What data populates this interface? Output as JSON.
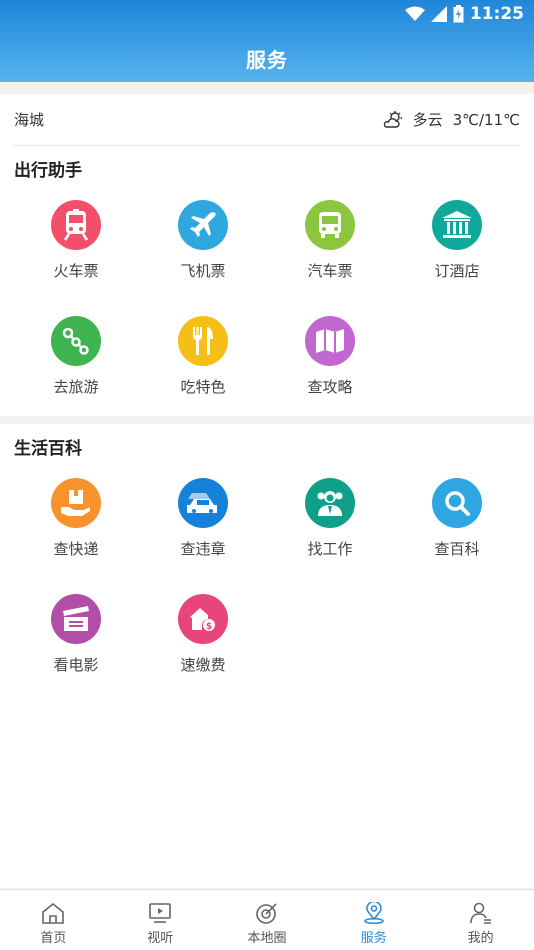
{
  "status": {
    "time": "11:25"
  },
  "header": {
    "title": "服务"
  },
  "weather": {
    "city": "海城",
    "condition": "多云",
    "temperature": "3℃/11℃"
  },
  "sections": [
    {
      "title": "出行助手",
      "items": [
        {
          "label": "火车票",
          "icon": "train-icon",
          "color": "#f24f6b"
        },
        {
          "label": "飞机票",
          "icon": "airplane-icon",
          "color": "#2fa8e0"
        },
        {
          "label": "汽车票",
          "icon": "bus-icon",
          "color": "#8cc63f"
        },
        {
          "label": "订酒店",
          "icon": "hotel-icon",
          "color": "#0fa89b"
        },
        {
          "label": "去旅游",
          "icon": "route-icon",
          "color": "#3fb34f"
        },
        {
          "label": "吃特色",
          "icon": "food-icon",
          "color": "#f6bf17"
        },
        {
          "label": "查攻略",
          "icon": "map-icon",
          "color": "#c068d0"
        }
      ]
    },
    {
      "title": "生活百科",
      "items": [
        {
          "label": "查快递",
          "icon": "package-icon",
          "color": "#f7922c"
        },
        {
          "label": "查违章",
          "icon": "car-icon",
          "color": "#1681d8"
        },
        {
          "label": "找工作",
          "icon": "people-icon",
          "color": "#10a08a"
        },
        {
          "label": "查百科",
          "icon": "search-icon",
          "color": "#2ea6e2"
        },
        {
          "label": "看电影",
          "icon": "clapper-icon",
          "color": "#b24da8"
        },
        {
          "label": "速缴费",
          "icon": "payment-icon",
          "color": "#e8457a"
        }
      ]
    }
  ],
  "tabs": [
    {
      "label": "首页",
      "icon": "home-icon",
      "active": false
    },
    {
      "label": "视听",
      "icon": "tv-icon",
      "active": false
    },
    {
      "label": "本地圈",
      "icon": "radar-icon",
      "active": false
    },
    {
      "label": "服务",
      "icon": "location-icon",
      "active": true
    },
    {
      "label": "我的",
      "icon": "user-icon",
      "active": false
    }
  ],
  "colors": {
    "header_start": "#1f86d8",
    "header_end": "#56b4ee",
    "active_tab": "#2b8ed6"
  }
}
